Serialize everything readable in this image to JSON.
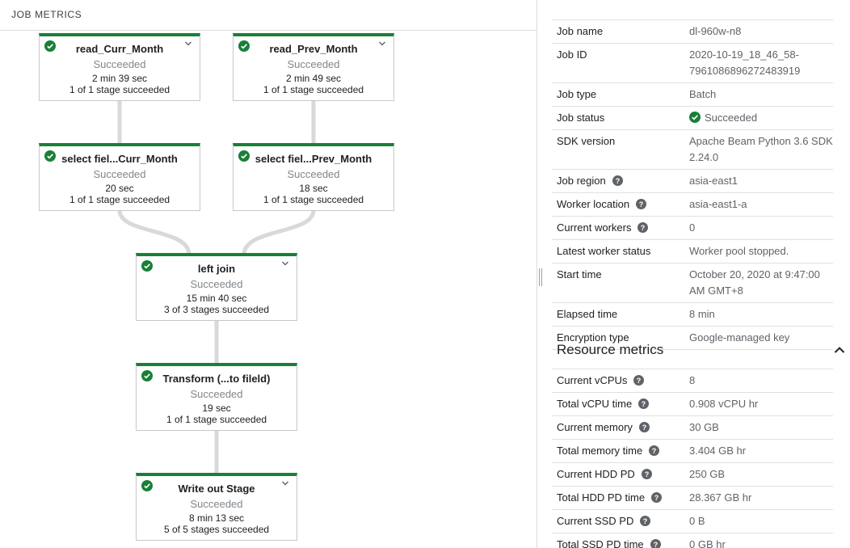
{
  "left_panel": {
    "tab_label": "JOB METRICS",
    "nodes": [
      {
        "title": "read_Curr_Month",
        "status": "Succeeded",
        "duration": "2 min 39 sec",
        "stages": "1 of 1 stage succeeded"
      },
      {
        "title": "read_Prev_Month",
        "status": "Succeeded",
        "duration": "2 min 49 sec",
        "stages": "1 of 1 stage succeeded"
      },
      {
        "title": "select fiel...Curr_Month",
        "status": "Succeeded",
        "duration": "20 sec",
        "stages": "1 of 1 stage succeeded"
      },
      {
        "title": "select fiel...Prev_Month",
        "status": "Succeeded",
        "duration": "18 sec",
        "stages": "1 of 1 stage succeeded"
      },
      {
        "title": "left join",
        "status": "Succeeded",
        "duration": "15 min 40 sec",
        "stages": "3 of 3 stages succeeded"
      },
      {
        "title": "Transform (...to fileld)",
        "status": "Succeeded",
        "duration": "19 sec",
        "stages": "1 of 1 stage succeeded"
      },
      {
        "title": "Write out Stage",
        "status": "Succeeded",
        "duration": "8 min 13 sec",
        "stages": "5 of 5 stages succeeded"
      }
    ]
  },
  "job_info": {
    "rows": [
      {
        "label": "Job name",
        "value": "dl-960w-n8"
      },
      {
        "label": "Job ID",
        "value": "2020-10-19_18_46_58-\n7961086896272483919"
      },
      {
        "label": "Job type",
        "value": "Batch"
      },
      {
        "label": "Job status",
        "value": "Succeeded"
      },
      {
        "label": "SDK version",
        "value": "Apache Beam Python 3.6 SDK 2.24.0"
      },
      {
        "label": "Job region",
        "value": "asia-east1"
      },
      {
        "label": "Worker location",
        "value": "asia-east1-a"
      },
      {
        "label": "Current workers",
        "value": "0"
      },
      {
        "label": "Latest worker status",
        "value": "Worker pool stopped."
      },
      {
        "label": "Start time",
        "value": "October 20, 2020 at 9:47:00 AM GMT+8"
      },
      {
        "label": "Elapsed time",
        "value": "8 min"
      },
      {
        "label": "Encryption type",
        "value": "Google-managed key"
      }
    ]
  },
  "resource_metrics": {
    "title": "Resource metrics",
    "rows": [
      {
        "label": "Current vCPUs",
        "value": "8"
      },
      {
        "label": "Total vCPU time",
        "value": "0.908 vCPU hr"
      },
      {
        "label": "Current memory",
        "value": "30 GB"
      },
      {
        "label": "Total memory time",
        "value": "3.404 GB hr"
      },
      {
        "label": "Current HDD PD",
        "value": "250 GB"
      },
      {
        "label": "Total HDD PD time",
        "value": "28.367 GB hr"
      },
      {
        "label": "Current SSD PD",
        "value": "0 B"
      },
      {
        "label": "Total SSD PD time",
        "value": "0 GB hr"
      }
    ]
  },
  "colors": {
    "success": "#188038",
    "edge": "#d9d9d9",
    "help_icon": "#5f6368"
  }
}
